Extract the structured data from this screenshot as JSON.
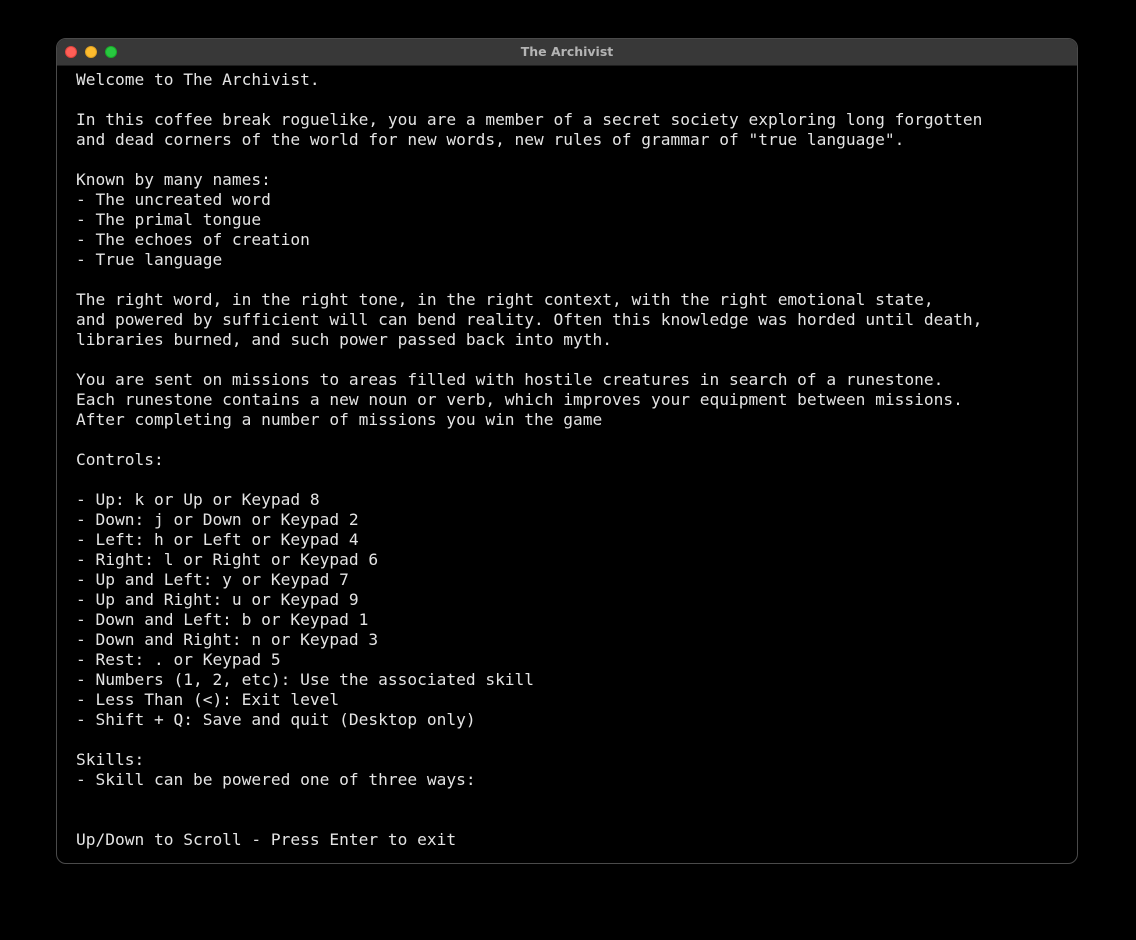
{
  "window": {
    "title": "The Archivist"
  },
  "screen": {
    "lines": [
      "Welcome to The Archivist.",
      "",
      "In this coffee break roguelike, you are a member of a secret society exploring long forgotten",
      "and dead corners of the world for new words, new rules of grammar of \"true language\".",
      "",
      "Known by many names:",
      "- The uncreated word",
      "- The primal tongue",
      "- The echoes of creation",
      "- True language",
      "",
      "The right word, in the right tone, in the right context, with the right emotional state,",
      "and powered by sufficient will can bend reality. Often this knowledge was horded until death,",
      "libraries burned, and such power passed back into myth.",
      "",
      "You are sent on missions to areas filled with hostile creatures in search of a runestone.",
      "Each runestone contains a new noun or verb, which improves your equipment between missions.",
      "After completing a number of missions you win the game",
      "",
      "Controls:",
      "",
      "- Up: k or Up or Keypad 8",
      "- Down: j or Down or Keypad 2",
      "- Left: h or Left or Keypad 4",
      "- Right: l or Right or Keypad 6",
      "- Up and Left: y or Keypad 7",
      "- Up and Right: u or Keypad 9",
      "- Down and Left: b or Keypad 1",
      "- Down and Right: n or Keypad 3",
      "- Rest: . or Keypad 5",
      "- Numbers (1, 2, etc): Use the associated skill",
      "- Less Than (<): Exit level",
      "- Shift + Q: Save and quit (Desktop only)",
      "",
      "Skills:",
      "- Skill can be powered one of three ways:",
      "",
      "",
      "Up/Down to Scroll - Press Enter to exit"
    ]
  }
}
